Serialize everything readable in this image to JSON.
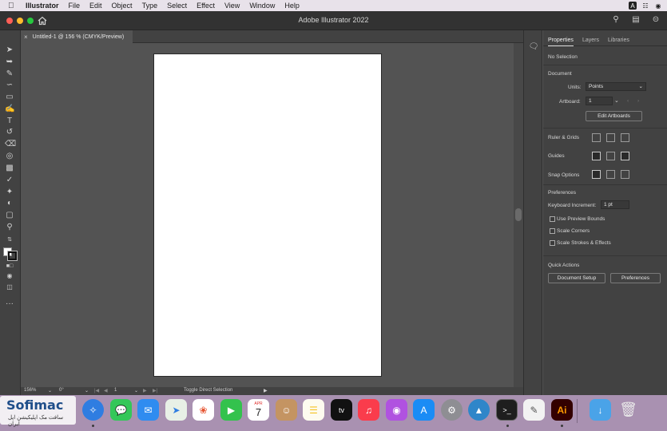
{
  "menubar": {
    "apple_icon": "apple-logo",
    "items": [
      "Illustrator",
      "File",
      "Edit",
      "Object",
      "Type",
      "Select",
      "Effect",
      "View",
      "Window",
      "Help"
    ]
  },
  "appbar": {
    "title": "Adobe Illustrator 2022"
  },
  "document": {
    "tab_label": "Untitled-1 @ 156 % (CMYK/Preview)"
  },
  "properties": {
    "tabs": [
      "Properties",
      "Layers",
      "Libraries"
    ],
    "selection": "No Selection",
    "document_section": "Document",
    "units_label": "Units:",
    "units_value": "Points",
    "artboard_label": "Artboard:",
    "artboard_value": "1",
    "edit_artboards": "Edit Artboards",
    "ruler_grids": "Ruler & Grids",
    "guides": "Guides",
    "snap_options": "Snap Options",
    "preferences_section": "Preferences",
    "keyboard_increment_label": "Keyboard Increment:",
    "keyboard_increment_value": "1 pt",
    "use_preview_bounds": "Use Preview Bounds",
    "scale_corners": "Scale Corners",
    "scale_strokes": "Scale Strokes & Effects",
    "quick_actions": "Quick Actions",
    "document_setup": "Document Setup",
    "preferences_btn": "Preferences"
  },
  "statusbar": {
    "zoom": "156%",
    "rotation": "0°",
    "artboard_num": "1",
    "tool_hint": "Toggle Direct Selection"
  },
  "dock": {
    "calendar_month": "APR",
    "calendar_day": "7",
    "tv_label": "tv",
    "ai_label": "Ai",
    "terminal_label": ">_"
  },
  "watermark": {
    "title": "Sofimac",
    "subtitle": "سافت مک اپلیکیشن اپل ایران"
  },
  "colors": {
    "accent": "#2d8ceb",
    "illustrator_bg": "#535353",
    "panel_bg": "#424242",
    "dock_bg": "#a991b1"
  }
}
